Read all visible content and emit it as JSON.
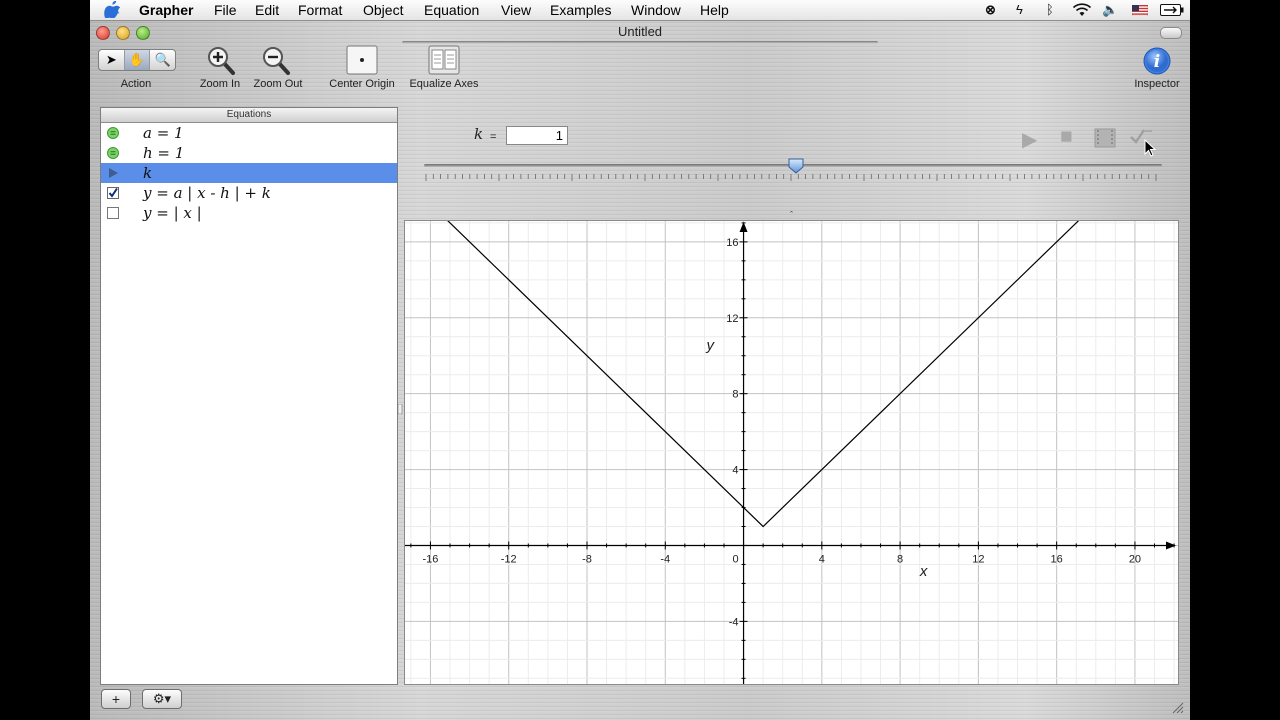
{
  "menubar": {
    "app": "Grapher",
    "items": [
      "File",
      "Edit",
      "Format",
      "Object",
      "Equation",
      "View",
      "Examples",
      "Window",
      "Help"
    ]
  },
  "window": {
    "title": "Untitled"
  },
  "toolbar": {
    "action_label": "Action",
    "zoom_in_label": "Zoom In",
    "zoom_out_label": "Zoom Out",
    "center_origin_label": "Center Origin",
    "equalize_axes_label": "Equalize Axes",
    "inspector_label": "Inspector"
  },
  "equations": {
    "header": "Equations",
    "rows": [
      {
        "text": "a = 1",
        "icon": "green-equals-icon"
      },
      {
        "text": "h = 1",
        "icon": "green-equals-icon"
      },
      {
        "text": "k",
        "icon": "play-triangle-icon",
        "selected": true
      },
      {
        "text": "y = a | x - h | + k",
        "icon": "checkbox-checked-icon"
      },
      {
        "text": "y = | x |",
        "icon": "checkbox-unchecked-icon"
      }
    ]
  },
  "bottom_bar": {
    "add_label": "+",
    "gear_label": "⚙▾"
  },
  "parameter": {
    "name": "k",
    "equals": "=",
    "value": "1",
    "slider_fraction": 0.5
  },
  "graph": {
    "x_axis_label": "x",
    "y_axis_label": "y",
    "origin_label": "0",
    "x_ticks": [
      -16,
      -12,
      -8,
      -4,
      4,
      8,
      12,
      16,
      20
    ],
    "y_ticks": [
      16,
      12,
      8,
      4,
      -4
    ],
    "x_range": [
      -17.3,
      22.2
    ],
    "y_range": [
      -7.3,
      17.1
    ],
    "curve": {
      "a": 1,
      "h": 1,
      "k": 1
    }
  }
}
